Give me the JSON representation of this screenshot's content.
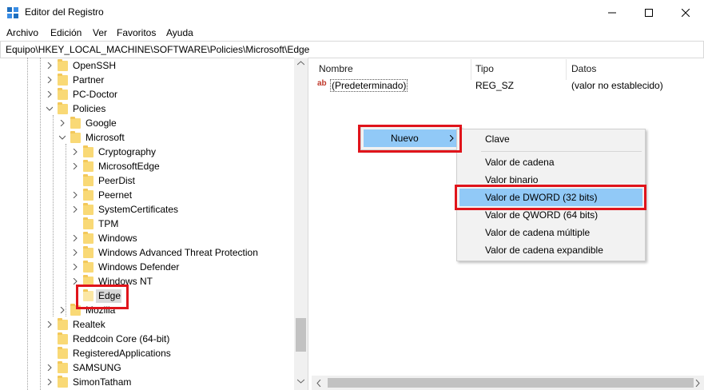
{
  "window": {
    "title": "Editor del Registro"
  },
  "menu": [
    "Archivo",
    "Edición",
    "Ver",
    "Favoritos",
    "Ayuda"
  ],
  "address": "Equipo\\HKEY_LOCAL_MACHINE\\SOFTWARE\\Policies\\Microsoft\\Edge",
  "tree": [
    {
      "label": "OpenSSH"
    },
    {
      "label": "Partner"
    },
    {
      "label": "PC-Doctor"
    },
    {
      "label": "Policies"
    },
    {
      "label": "Google"
    },
    {
      "label": "Microsoft"
    },
    {
      "label": "Cryptography"
    },
    {
      "label": "MicrosoftEdge"
    },
    {
      "label": "PeerDist"
    },
    {
      "label": "Peernet"
    },
    {
      "label": "SystemCertificates"
    },
    {
      "label": "TPM"
    },
    {
      "label": "Windows"
    },
    {
      "label": "Windows Advanced Threat Protection"
    },
    {
      "label": "Windows Defender"
    },
    {
      "label": "Windows NT"
    },
    {
      "label": "Edge"
    },
    {
      "label": "Mozilla"
    },
    {
      "label": "Realtek"
    },
    {
      "label": "Reddcoin Core (64-bit)"
    },
    {
      "label": "RegisteredApplications"
    },
    {
      "label": "SAMSUNG"
    },
    {
      "label": "SimonTatham"
    }
  ],
  "columns": {
    "name": "Nombre",
    "type": "Tipo",
    "data": "Datos"
  },
  "values": [
    {
      "icon": "ab",
      "name": "(Predeterminado)",
      "type": "REG_SZ",
      "data": "(valor no establecido)"
    }
  ],
  "context_menu": {
    "nuevo": "Nuevo"
  },
  "submenu": {
    "clave": "Clave",
    "items": [
      "Valor de cadena",
      "Valor binario",
      "Valor de DWORD (32 bits)",
      "Valor de QWORD (64 bits)",
      "Valor de cadena múltiple",
      "Valor de cadena expandible"
    ]
  },
  "colors": {
    "highlight_box": "#e0141b",
    "menu_hover": "#91c9f7",
    "folder": "#f9d976"
  }
}
